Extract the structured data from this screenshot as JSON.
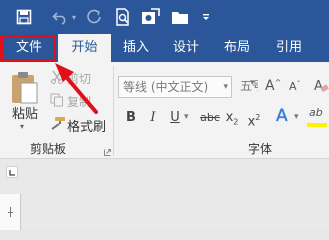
{
  "colors": {
    "accent": "#2b579a",
    "highlight": "#e0101b",
    "ribbon_bg": "#f3f3f3"
  },
  "quick_access": {
    "icons": [
      "save-icon",
      "undo-icon",
      "redo-icon",
      "print-preview-icon",
      "touch-mode-icon",
      "folder-icon",
      "customize-dropdown-icon"
    ]
  },
  "tabs": [
    {
      "label": "文件"
    },
    {
      "label": "开始"
    },
    {
      "label": "插入"
    },
    {
      "label": "设计"
    },
    {
      "label": "布局"
    },
    {
      "label": "引用"
    }
  ],
  "clipboard": {
    "paste_label": "粘贴",
    "cut_label": "剪切",
    "copy_label": "复制",
    "format_painter_label": "格式刷",
    "group_label": "剪贴板"
  },
  "font": {
    "font_name": "等线 (中文正文)",
    "font_size": "五号",
    "grow_label": "A",
    "shrink_label": "A",
    "bold": "B",
    "italic": "I",
    "underline": "U",
    "strikethrough": "abc",
    "subscript": "x",
    "superscript": "x",
    "text_effects": "A",
    "highlight": "ab",
    "group_label": "字体"
  }
}
